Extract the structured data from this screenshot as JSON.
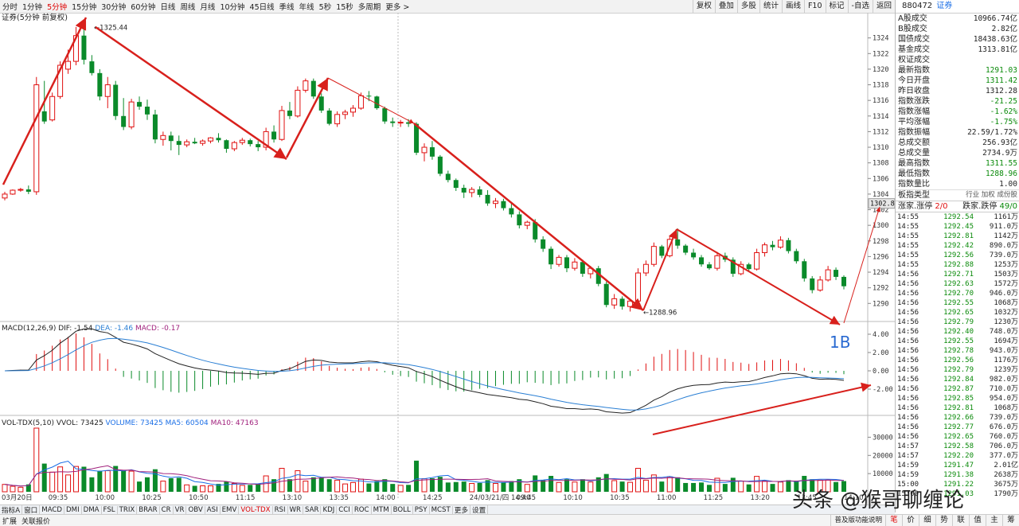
{
  "top_tabs": [
    "分时",
    "1分钟",
    "5分钟",
    "15分钟",
    "30分钟",
    "60分钟",
    "日线",
    "周线",
    "月线",
    "10分钟",
    "45日线",
    "季线",
    "年线",
    "5秒",
    "15秒",
    "多周期",
    "更多 >"
  ],
  "active_tab": "5分钟",
  "top_right_buttons": [
    "复权",
    "叠加",
    "多股",
    "统计",
    "画线",
    "F10",
    "标记",
    "-自选",
    "返回"
  ],
  "chart_title": "证券(5分钟 前复权)",
  "price_axis": {
    "min": 1288.5,
    "max": 1325.8,
    "ticks": [
      1290,
      1292,
      1294,
      1296,
      1298,
      1300,
      1302,
      1304,
      1306,
      1308,
      1310,
      1312,
      1314,
      1316,
      1318,
      1320,
      1322,
      1324
    ],
    "current_tag": "1302.8"
  },
  "annotations": {
    "high_label": "1325.44",
    "low_label": "1288.96",
    "label_1b": "1B"
  },
  "time_axis": [
    "03月20日",
    "09:35",
    "10:00",
    "10:25",
    "10:50",
    "11:15",
    "13:10",
    "13:35",
    "14:00",
    "14:25",
    "24/03/21/四 14:40",
    "09:45",
    "10:10",
    "10:35",
    "11:00",
    "11:25",
    "13:20",
    "13:45",
    "14:10"
  ],
  "macd": {
    "title": "MACD(12,26,9)",
    "dif": "DIF: -1.54",
    "dea": "DEA: -1.46",
    "macd": "MACD: -0.17",
    "ticks": [
      "4.00",
      "2.00",
      "0.00",
      "-2.00"
    ],
    "dif_color": "#222222",
    "dea_color": "#2a7fd4"
  },
  "vol": {
    "title": "VOL-TDX(5,10)",
    "vvol": "VVOL: 73425",
    "volume": "VOLUME: 73425",
    "ma5": "MA5: 60504",
    "ma10": "MA10: 47163",
    "ticks": [
      "30000",
      "20000",
      "10000"
    ]
  },
  "chart_data": {
    "type": "candlestick",
    "bars": [
      [
        1303.5,
        1304.3,
        1303.2,
        1304.0
      ],
      [
        1304.0,
        1304.6,
        1303.9,
        1304.5
      ],
      [
        1304.5,
        1304.8,
        1304.3,
        1304.6
      ],
      [
        1304.6,
        1305.1,
        1304.0,
        1304.3
      ],
      [
        1304.3,
        1319.0,
        1303.9,
        1318.0
      ],
      [
        1314.6,
        1318.5,
        1313.0,
        1313.3
      ],
      [
        1313.5,
        1317.0,
        1313.3,
        1316.5
      ],
      [
        1316.5,
        1321.0,
        1316.2,
        1320.5
      ],
      [
        1320.0,
        1322.5,
        1319.4,
        1321.0
      ],
      [
        1321.0,
        1325.4,
        1320.5,
        1324.3
      ],
      [
        1324.3,
        1325.44,
        1320.6,
        1321.2
      ],
      [
        1321.0,
        1321.8,
        1319.2,
        1319.5
      ],
      [
        1319.5,
        1320.0,
        1316.0,
        1316.5
      ],
      [
        1316.5,
        1319.0,
        1315.0,
        1318.0
      ],
      [
        1318.0,
        1318.5,
        1313.5,
        1314.0
      ],
      [
        1314.0,
        1316.3,
        1312.2,
        1312.6
      ],
      [
        1312.6,
        1316.2,
        1312.3,
        1315.8
      ],
      [
        1315.8,
        1316.5,
        1314.8,
        1315.2
      ],
      [
        1315.2,
        1316.1,
        1313.5,
        1314.2
      ],
      [
        1314.2,
        1314.8,
        1310.5,
        1311.0
      ],
      [
        1311.0,
        1312.0,
        1310.2,
        1311.5
      ],
      [
        1311.5,
        1312.0,
        1309.6,
        1310.8
      ],
      [
        1310.8,
        1311.5,
        1309.0,
        1310.3
      ],
      [
        1310.3,
        1311.0,
        1310.0,
        1310.7
      ],
      [
        1310.7,
        1311.2,
        1310.4,
        1310.5
      ],
      [
        1310.5,
        1311.0,
        1310.2,
        1310.8
      ],
      [
        1310.8,
        1311.3,
        1310.5,
        1311.2
      ],
      [
        1311.2,
        1311.8,
        1310.6,
        1310.9
      ],
      [
        1310.9,
        1311.0,
        1309.3,
        1309.8
      ],
      [
        1309.8,
        1310.8,
        1309.5,
        1310.6
      ],
      [
        1310.6,
        1311.2,
        1310.3,
        1310.9
      ],
      [
        1310.9,
        1311.1,
        1310.1,
        1310.4
      ],
      [
        1310.4,
        1310.8,
        1309.5,
        1310.0
      ],
      [
        1310.0,
        1312.5,
        1309.6,
        1312.0
      ],
      [
        1312.0,
        1312.8,
        1310.6,
        1311.0
      ],
      [
        1311.0,
        1315.3,
        1310.8,
        1314.7
      ],
      [
        1314.7,
        1315.8,
        1313.6,
        1314.0
      ],
      [
        1314.0,
        1317.8,
        1313.8,
        1317.3
      ],
      [
        1317.3,
        1318.8,
        1317.0,
        1318.5
      ],
      [
        1318.5,
        1318.8,
        1316.2,
        1316.5
      ],
      [
        1316.5,
        1316.9,
        1314.4,
        1314.7
      ],
      [
        1314.7,
        1315.0,
        1312.8,
        1313.0
      ],
      [
        1313.0,
        1314.6,
        1312.6,
        1314.2
      ],
      [
        1314.2,
        1314.8,
        1313.6,
        1314.5
      ],
      [
        1314.5,
        1315.4,
        1313.9,
        1315.0
      ],
      [
        1315.0,
        1317.0,
        1314.8,
        1316.6
      ],
      [
        1316.6,
        1317.2,
        1315.9,
        1316.5
      ],
      [
        1316.5,
        1316.6,
        1314.8,
        1315.0
      ],
      [
        1315.0,
        1315.2,
        1313.0,
        1313.3
      ],
      [
        1313.3,
        1313.8,
        1312.6,
        1313.1
      ],
      [
        1313.1,
        1313.5,
        1312.6,
        1313.2
      ],
      [
        1313.2,
        1313.6,
        1312.6,
        1313.0
      ],
      [
        1313.0,
        1313.2,
        1309.0,
        1309.3
      ],
      [
        1309.3,
        1310.5,
        1308.2,
        1310.0
      ],
      [
        1310.0,
        1310.8,
        1308.4,
        1308.8
      ],
      [
        1308.8,
        1309.0,
        1306.3,
        1306.6
      ],
      [
        1306.6,
        1307.0,
        1305.5,
        1305.8
      ],
      [
        1305.8,
        1306.0,
        1304.4,
        1304.8
      ],
      [
        1304.8,
        1305.2,
        1303.5,
        1304.2
      ],
      [
        1304.2,
        1304.9,
        1303.6,
        1304.6
      ],
      [
        1304.6,
        1305.0,
        1303.6,
        1303.9
      ],
      [
        1303.9,
        1304.5,
        1302.5,
        1302.8
      ],
      [
        1302.8,
        1303.5,
        1302.2,
        1303.1
      ],
      [
        1303.1,
        1303.4,
        1301.9,
        1302.2
      ],
      [
        1302.2,
        1302.8,
        1301.0,
        1301.4
      ],
      [
        1301.4,
        1301.8,
        1299.6,
        1300.0
      ],
      [
        1300.0,
        1300.6,
        1299.5,
        1300.4
      ],
      [
        1300.4,
        1300.8,
        1297.8,
        1298.2
      ],
      [
        1298.2,
        1298.6,
        1296.6,
        1297.0
      ],
      [
        1297.0,
        1297.3,
        1294.4,
        1295.0
      ],
      [
        1295.0,
        1296.2,
        1294.7,
        1295.9
      ],
      [
        1295.9,
        1296.2,
        1294.0,
        1294.5
      ],
      [
        1294.5,
        1295.8,
        1294.2,
        1295.3
      ],
      [
        1295.3,
        1295.6,
        1293.4,
        1293.8
      ],
      [
        1293.8,
        1294.8,
        1293.2,
        1294.5
      ],
      [
        1294.5,
        1294.8,
        1292.2,
        1292.5
      ],
      [
        1292.5,
        1292.8,
        1289.5,
        1289.8
      ],
      [
        1289.8,
        1291.2,
        1289.3,
        1290.6
      ],
      [
        1290.6,
        1290.9,
        1289.2,
        1289.6
      ],
      [
        1289.6,
        1290.5,
        1288.96,
        1290.3
      ],
      [
        1290.3,
        1294.5,
        1290.0,
        1293.9
      ],
      [
        1293.9,
        1295.5,
        1293.5,
        1295.0
      ],
      [
        1295.0,
        1297.8,
        1294.7,
        1297.3
      ],
      [
        1297.3,
        1297.5,
        1295.8,
        1296.1
      ],
      [
        1296.1,
        1298.6,
        1295.9,
        1298.2
      ],
      [
        1298.2,
        1299.6,
        1297.0,
        1297.4
      ],
      [
        1297.4,
        1297.6,
        1296.2,
        1296.5
      ],
      [
        1296.5,
        1297.0,
        1295.6,
        1295.9
      ],
      [
        1295.9,
        1296.2,
        1294.7,
        1295.0
      ],
      [
        1295.0,
        1295.3,
        1294.3,
        1294.5
      ],
      [
        1294.5,
        1296.6,
        1294.2,
        1296.1
      ],
      [
        1296.1,
        1296.5,
        1295.3,
        1295.6
      ],
      [
        1295.6,
        1295.9,
        1293.4,
        1293.8
      ],
      [
        1293.8,
        1295.4,
        1293.6,
        1295.0
      ],
      [
        1295.0,
        1295.2,
        1294.1,
        1294.4
      ],
      [
        1294.4,
        1297.0,
        1294.2,
        1296.5
      ],
      [
        1296.5,
        1297.8,
        1296.0,
        1297.5
      ],
      [
        1297.5,
        1298.0,
        1296.8,
        1297.2
      ],
      [
        1297.2,
        1298.6,
        1297.0,
        1298.1
      ],
      [
        1298.1,
        1298.4,
        1296.4,
        1296.7
      ],
      [
        1296.7,
        1297.0,
        1295.1,
        1295.4
      ],
      [
        1295.4,
        1295.7,
        1292.8,
        1293.2
      ],
      [
        1293.2,
        1293.5,
        1291.3,
        1291.7
      ],
      [
        1291.7,
        1293.5,
        1291.5,
        1293.0
      ],
      [
        1293.0,
        1294.8,
        1292.8,
        1294.3
      ],
      [
        1294.3,
        1294.6,
        1293.0,
        1293.4
      ],
      [
        1293.4,
        1293.6,
        1291.8,
        1292.2
      ]
    ],
    "volume_max": 35000
  },
  "panel": {
    "code": "880472",
    "name": "证券",
    "stats": [
      {
        "k": "A股成交",
        "v": "10966.74亿",
        "c": ""
      },
      {
        "k": "B股成交",
        "v": "2.82亿",
        "c": ""
      },
      {
        "k": "国债成交",
        "v": "18438.63亿",
        "c": ""
      },
      {
        "k": "基金成交",
        "v": "1313.81亿",
        "c": ""
      },
      {
        "k": "权证成交",
        "v": "",
        "c": ""
      },
      {
        "k": "最新指数",
        "v": "1291.03",
        "c": "green"
      },
      {
        "k": "今日开盘",
        "v": "1311.42",
        "c": "green"
      },
      {
        "k": "昨日收盘",
        "v": "1312.28",
        "c": ""
      },
      {
        "k": "指数涨跌",
        "v": "-21.25",
        "c": "green"
      },
      {
        "k": "指数涨幅",
        "v": "-1.62%",
        "c": "green"
      },
      {
        "k": "平均涨幅",
        "v": "-1.75%",
        "c": "green"
      },
      {
        "k": "指数振幅",
        "v": "22.59/1.72%",
        "c": ""
      },
      {
        "k": "总成交额",
        "v": "256.93亿",
        "c": ""
      },
      {
        "k": "总成交量",
        "v": "2734.9万",
        "c": ""
      },
      {
        "k": "最高指数",
        "v": "1311.55",
        "c": "green"
      },
      {
        "k": "最低指数",
        "v": "1288.96",
        "c": "green"
      },
      {
        "k": "指数量比",
        "v": "1.00",
        "c": ""
      }
    ],
    "ind_type_label": "板指类型",
    "ind_type_opts": "行业 加权 成份股",
    "updown": {
      "up_label": "涨家.涨停",
      "up_val": "2/0",
      "down_label": "跌家.跌停",
      "down_val": "49/0"
    },
    "ticks": [
      [
        "14:55",
        "1292.54",
        "1161万"
      ],
      [
        "14:55",
        "1292.45",
        "911.0万"
      ],
      [
        "14:55",
        "1292.81",
        "1142万"
      ],
      [
        "14:55",
        "1292.42",
        "890.0万"
      ],
      [
        "14:55",
        "1292.56",
        "739.0万"
      ],
      [
        "14:55",
        "1292.88",
        "1253万"
      ],
      [
        "14:56",
        "1292.71",
        "1503万"
      ],
      [
        "14:56",
        "1292.63",
        "1572万"
      ],
      [
        "14:56",
        "1292.70",
        "946.0万"
      ],
      [
        "14:56",
        "1292.55",
        "1068万"
      ],
      [
        "14:56",
        "1292.65",
        "1032万"
      ],
      [
        "14:56",
        "1292.79",
        "1230万"
      ],
      [
        "14:56",
        "1292.40",
        "748.0万"
      ],
      [
        "14:56",
        "1292.55",
        "1694万"
      ],
      [
        "14:56",
        "1292.78",
        "943.0万"
      ],
      [
        "14:56",
        "1292.56",
        "1176万"
      ],
      [
        "14:56",
        "1292.79",
        "1239万"
      ],
      [
        "14:56",
        "1292.84",
        "982.0万"
      ],
      [
        "14:56",
        "1292.87",
        "710.0万"
      ],
      [
        "14:56",
        "1292.85",
        "954.0万"
      ],
      [
        "14:56",
        "1292.81",
        "1068万"
      ],
      [
        "14:56",
        "1292.66",
        "739.0万"
      ],
      [
        "14:56",
        "1292.77",
        "676.0万"
      ],
      [
        "14:56",
        "1292.65",
        "760.0万"
      ],
      [
        "14:57",
        "1292.58",
        "706.0万"
      ],
      [
        "14:57",
        "1292.20",
        "377.0万"
      ],
      [
        "14:59",
        "1291.47",
        "2.01亿"
      ],
      [
        "14:59",
        "1291.38",
        "2638万"
      ],
      [
        "15:00",
        "1291.22",
        "3675万"
      ],
      [
        "15:00",
        "1291.03",
        "1790万"
      ]
    ]
  },
  "bottom_tabs": [
    "指标A",
    "窗口",
    "MACD",
    "DMI",
    "DMA",
    "FSL",
    "TRIX",
    "BRAR",
    "CR",
    "VR",
    "OBV",
    "ASI",
    "EMV",
    "VOL-TDX",
    "RSI",
    "WR",
    "SAR",
    "KDJ",
    "CCI",
    "ROC",
    "MTM",
    "BOLL",
    "PSY",
    "MCST",
    "更多",
    "设置"
  ],
  "active_bottom_tab": "VOL-TDX",
  "statusbar": {
    "left1": "扩展",
    "left2": "关联报价",
    "right_btns": [
      "笔",
      "价",
      "细",
      "势",
      "联",
      "值",
      "主",
      "筹"
    ],
    "hint": "普及版功能说明"
  },
  "watermark": "头条 @猴哥聊缠论",
  "colors": {
    "up": "#e01010",
    "down": "#0a8a2a",
    "arrow": "#d8201c",
    "blue_label": "#2a6ad1"
  }
}
